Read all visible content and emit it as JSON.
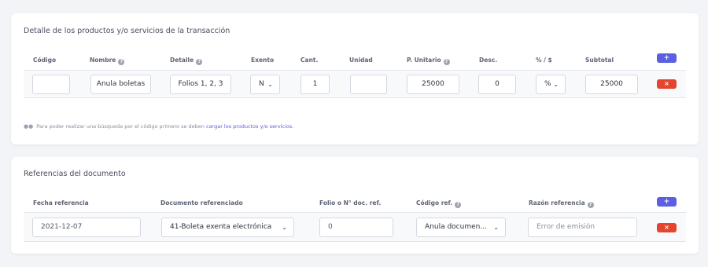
{
  "products": {
    "title": "Detalle de los productos y/o servicios de la transacción",
    "headers": {
      "codigo": "Código",
      "nombre": "Nombre",
      "detalle": "Detalle",
      "exento": "Exento",
      "cant": "Cant.",
      "unidad": "Unidad",
      "p_unitario": "P. Unitario",
      "desc": "Desc.",
      "pct": "% / $",
      "subtotal": "Subtotal"
    },
    "row": {
      "codigo": "",
      "nombre": "Anula boletas",
      "detalle": "Folios 1, 2, 3",
      "exento": "N",
      "cant": "1",
      "unidad": "",
      "p_unitario": "25000",
      "desc": "0",
      "pct": "%",
      "subtotal": "25000"
    },
    "add_label": "+",
    "delete_label": "×",
    "note_text": "Para poder realizar una búsqueda por el código primero se deben",
    "note_link": "cargar los productos y/o servicios."
  },
  "references": {
    "title": "Referencias del documento",
    "headers": {
      "fecha": "Fecha referencia",
      "documento": "Documento referenciado",
      "folio": "Folio o N° doc. ref.",
      "codigo": "Código ref.",
      "razon": "Razón referencia"
    },
    "row": {
      "fecha": "2021-12-07",
      "documento": "41-Boleta exenta electrónica",
      "folio": "0",
      "codigo": "Anula documen...",
      "razon_placeholder": "Error de emisión"
    },
    "add_label": "+",
    "delete_label": "×"
  },
  "icons": {
    "info": "info-circle-icon",
    "chevron": "chevron-down-icon",
    "users": "users-icon"
  },
  "colors": {
    "primary": "#5b5fe0",
    "danger": "#e4452e"
  }
}
